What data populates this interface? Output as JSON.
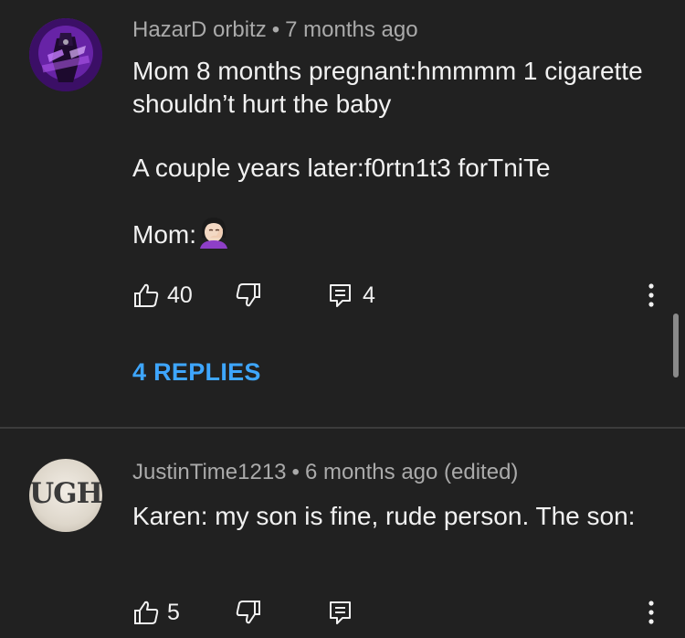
{
  "comments": [
    {
      "author": "HazarD orbitz",
      "time": "7 months ago",
      "paragraphs": [
        "Mom 8 months pregnant:hmmmm 1 cigarette shouldn’t hurt the baby",
        "A couple years later:f0rtn1t3 forTniTe",
        "Mom:"
      ],
      "emoji": "face-palm-emoji",
      "likes": "40",
      "reply_count": "4",
      "replies_label": "4 REPLIES",
      "avatar": "fortnite-character-avatar"
    },
    {
      "author": "JustinTime1213",
      "time": "6 months ago (edited)",
      "text": "Karen: my son is fine, rude person. The son:",
      "likes": "5",
      "avatar_text": "UGH"
    }
  ],
  "separator": "•",
  "colors": {
    "background": "#212121",
    "text": "#f1f1f1",
    "meta": "#aaaaaa",
    "link": "#3ea6ff"
  },
  "icons": [
    "thumbs-up-icon",
    "thumbs-down-icon",
    "reply-icon",
    "more-vert-icon"
  ]
}
